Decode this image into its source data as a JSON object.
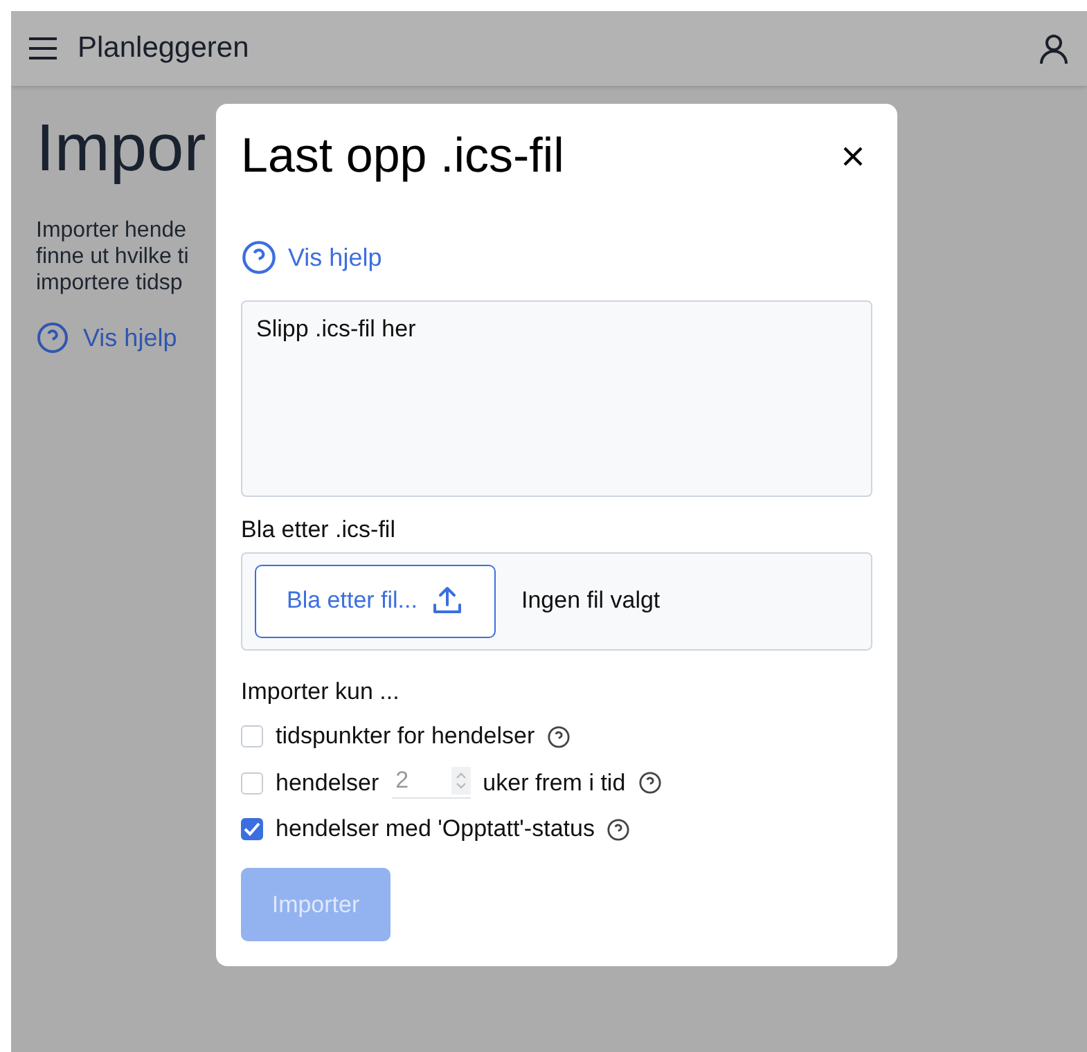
{
  "app_bar": {
    "title": "Planleggeren"
  },
  "background_page": {
    "heading": "Impor",
    "intro_lines": [
      "Importer hende",
      "finne ut hvilke ti",
      "importere tidsp"
    ],
    "help_link": "Vis hjelp"
  },
  "dialog": {
    "title": "Last opp .ics-fil",
    "help_link": "Vis hjelp",
    "drop_zone": {
      "text": "Slipp .ics-fil her"
    },
    "browse_label": "Bla etter .ics-fil",
    "browse_button": "Bla etter fil...",
    "file_status": "Ingen fil valgt",
    "options_label": "Importer kun ...",
    "options": [
      {
        "kind": "plain",
        "label": "tidspunkter for hendelser",
        "checked": false
      },
      {
        "kind": "weeks",
        "label": "hendelser",
        "value": "2",
        "suffix": "uker frem i tid",
        "checked": false
      },
      {
        "kind": "plain",
        "label": "hendelser med 'Opptatt'-status",
        "checked": true
      }
    ],
    "submit": {
      "label": "Importer",
      "disabled": true
    }
  }
}
